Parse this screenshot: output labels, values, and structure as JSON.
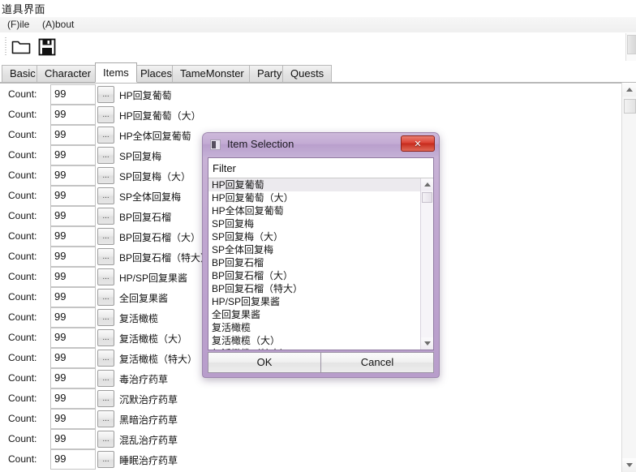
{
  "page": {
    "caption": "道具界面"
  },
  "menubar": {
    "items": [
      {
        "label": "(F)ile",
        "name": "menu-file"
      },
      {
        "label": "(A)bout",
        "name": "menu-about"
      }
    ]
  },
  "toolbar": {
    "buttons": [
      {
        "icon": "folder-open-icon",
        "name": "open-file-button"
      },
      {
        "icon": "floppy-save-icon",
        "name": "save-file-button"
      }
    ]
  },
  "tabs": [
    {
      "label": "Basic",
      "active": false
    },
    {
      "label": "Character",
      "active": false
    },
    {
      "label": "Items",
      "active": true
    },
    {
      "label": "Places",
      "active": false
    },
    {
      "label": "TameMonster",
      "active": false
    },
    {
      "label": "Party",
      "active": false
    },
    {
      "label": "Quests",
      "active": false
    }
  ],
  "items_panel": {
    "count_label": "Count:",
    "browse_label": "...",
    "rows": [
      {
        "count": "99",
        "name": "HP回复葡萄"
      },
      {
        "count": "99",
        "name": "HP回复葡萄（大）"
      },
      {
        "count": "99",
        "name": "HP全体回复葡萄"
      },
      {
        "count": "99",
        "name": "SP回复梅"
      },
      {
        "count": "99",
        "name": "SP回复梅（大）"
      },
      {
        "count": "99",
        "name": "SP全体回复梅"
      },
      {
        "count": "99",
        "name": "BP回复石榴"
      },
      {
        "count": "99",
        "name": "BP回复石榴（大）"
      },
      {
        "count": "99",
        "name": "BP回复石榴（特大）"
      },
      {
        "count": "99",
        "name": "HP/SP回复果酱"
      },
      {
        "count": "99",
        "name": "全回复果酱"
      },
      {
        "count": "99",
        "name": "复活橄榄"
      },
      {
        "count": "99",
        "name": "复活橄榄（大）"
      },
      {
        "count": "99",
        "name": "复活橄榄（特大）"
      },
      {
        "count": "99",
        "name": "毒治疗药草"
      },
      {
        "count": "99",
        "name": "沉默治疗药草"
      },
      {
        "count": "99",
        "name": "黑暗治疗药草"
      },
      {
        "count": "99",
        "name": "混乱治疗药草"
      },
      {
        "count": "99",
        "name": "睡眠治疗药草"
      }
    ]
  },
  "dialog": {
    "title": "Item Selection",
    "close_label": "✕",
    "filter": {
      "label": "Filter",
      "value": "",
      "placeholder": ""
    },
    "list": [
      {
        "label": "HP回复葡萄",
        "selected": true
      },
      {
        "label": "HP回复葡萄（大）",
        "selected": false
      },
      {
        "label": "HP全体回复葡萄",
        "selected": false
      },
      {
        "label": "SP回复梅",
        "selected": false
      },
      {
        "label": "SP回复梅（大）",
        "selected": false
      },
      {
        "label": "SP全体回复梅",
        "selected": false
      },
      {
        "label": "BP回复石榴",
        "selected": false
      },
      {
        "label": "BP回复石榴（大）",
        "selected": false
      },
      {
        "label": "BP回复石榴（特大）",
        "selected": false
      },
      {
        "label": "HP/SP回复果酱",
        "selected": false
      },
      {
        "label": "全回复果酱",
        "selected": false
      },
      {
        "label": "复活橄榄",
        "selected": false
      },
      {
        "label": "复活橄榄（大）",
        "selected": false
      },
      {
        "label": "复活橄榄（特大）",
        "selected": false
      }
    ],
    "buttons": {
      "ok": "OK",
      "cancel": "Cancel"
    }
  },
  "colors": {
    "dialog_frame": "#b89dcb",
    "close_button": "#dc4436",
    "tab_active_bg": "#ffffff",
    "panel_bg": "#ffffff"
  }
}
